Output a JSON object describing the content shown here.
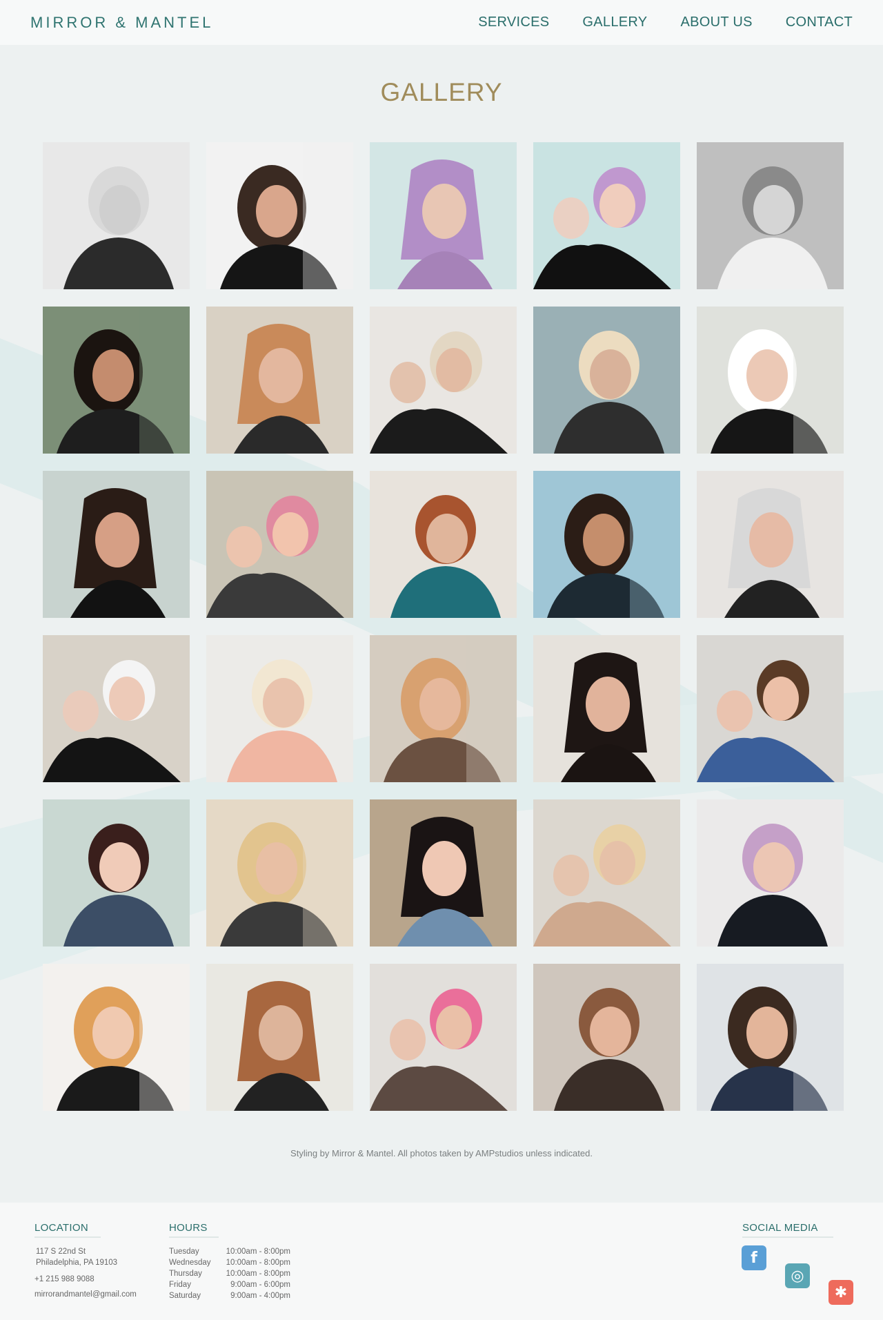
{
  "brand": {
    "logo": "MIRROR & MANTEL"
  },
  "nav": [
    {
      "label": "SERVICES"
    },
    {
      "label": "GALLERY"
    },
    {
      "label": "ABOUT US"
    },
    {
      "label": "CONTACT"
    }
  ],
  "page": {
    "title": "GALLERY",
    "credit": "Styling by Mirror & Mantel. All photos taken by AMPstudios unless indicated."
  },
  "gallery": {
    "photos": [
      {
        "name": "photo-1",
        "desc": "bw-seated-woman",
        "bg": "#e8e8e8",
        "fg": "#2b2b2b",
        "hair": "#d9d9d9",
        "skin": "#cfcfcf"
      },
      {
        "name": "photo-2",
        "desc": "braid-portrait",
        "bg": "#f2f2f2",
        "fg": "#151515",
        "hair": "#3a2a22",
        "skin": "#d9a68c"
      },
      {
        "name": "photo-3",
        "desc": "lavender-bob-profile",
        "bg": "#d3e6e5",
        "fg": "#a682b8",
        "hair": "#b28ec7",
        "skin": "#e8c6b4"
      },
      {
        "name": "photo-4",
        "desc": "lavender-bob-front",
        "bg": "#c9e3e2",
        "fg": "#111111",
        "hair": "#c098cf",
        "skin": "#f0cdbd"
      },
      {
        "name": "photo-5",
        "desc": "bw-hair-wash",
        "bg": "#bfbfbf",
        "fg": "#f0f0f0",
        "hair": "#8a8a8a",
        "skin": "#d5d5d5"
      },
      {
        "name": "photo-6",
        "desc": "styling-side-hair",
        "bg": "#7c8f77",
        "fg": "#1e1e1e",
        "hair": "#1b1410",
        "skin": "#c48c6e"
      },
      {
        "name": "photo-7",
        "desc": "copper-bob-back",
        "bg": "#d9d1c4",
        "fg": "#2a2a2a",
        "hair": "#c98a5a",
        "skin": "#e3b79e"
      },
      {
        "name": "photo-8",
        "desc": "pixie-cut-stylist",
        "bg": "#e9e6e2",
        "fg": "#1b1b1b",
        "hair": "#e3d7c3",
        "skin": "#e2bba3"
      },
      {
        "name": "photo-9",
        "desc": "blonde-pixie-color",
        "bg": "#9ab0b5",
        "fg": "#2e2e2e",
        "hair": "#ecdcc0",
        "skin": "#d9b29a"
      },
      {
        "name": "photo-10",
        "desc": "dryer-cap-client",
        "bg": "#dfe1dc",
        "fg": "#161616",
        "hair": "#ffffff",
        "skin": "#ecc9b6"
      },
      {
        "name": "photo-11",
        "desc": "braid-mustache",
        "bg": "#c8d3cf",
        "fg": "#121212",
        "hair": "#2a1c16",
        "skin": "#d69f85"
      },
      {
        "name": "photo-12",
        "desc": "pink-braid-smile",
        "bg": "#c9c4b5",
        "fg": "#3a3a3a",
        "hair": "#e08aa0",
        "skin": "#f2c4ad"
      },
      {
        "name": "photo-13",
        "desc": "teal-top-wash",
        "bg": "#e8e3dc",
        "fg": "#1f6f7a",
        "hair": "#a8542f",
        "skin": "#e0b59b"
      },
      {
        "name": "photo-14",
        "desc": "man-smiling",
        "bg": "#9fc6d6",
        "fg": "#1d2a33",
        "hair": "#2b1d16",
        "skin": "#c58e6c"
      },
      {
        "name": "photo-15",
        "desc": "color-application",
        "bg": "#e7e4e1",
        "fg": "#222222",
        "hair": "#d8d8d8",
        "skin": "#e6bba6"
      },
      {
        "name": "photo-16",
        "desc": "reading-magazine",
        "bg": "#d8d2c8",
        "fg": "#141414",
        "hair": "#f4f4f4",
        "skin": "#edcab8"
      },
      {
        "name": "photo-17",
        "desc": "stripe-shirt-wash",
        "bg": "#ecebe8",
        "fg": "#f0b6a2",
        "hair": "#f2e7d2",
        "skin": "#e9c3ad"
      },
      {
        "name": "photo-18",
        "desc": "long-hair-cut",
        "bg": "#d5ccc0",
        "fg": "#6b5141",
        "hair": "#d8a170",
        "skin": "#e6b89c"
      },
      {
        "name": "photo-19",
        "desc": "dark-angled-bob",
        "bg": "#e6e2dc",
        "fg": "#1b1412",
        "hair": "#1e1614",
        "skin": "#e1b39b"
      },
      {
        "name": "photo-20",
        "desc": "wavy-hair-smile",
        "bg": "#d9d7d3",
        "fg": "#3b5f9a",
        "hair": "#5a3b26",
        "skin": "#ecc0a8"
      },
      {
        "name": "photo-21",
        "desc": "vintage-updo-dryer",
        "bg": "#c9d8d2",
        "fg": "#3c4e66",
        "hair": "#3a1f1c",
        "skin": "#f0cbb8"
      },
      {
        "name": "photo-22",
        "desc": "blonde-strands-cut",
        "bg": "#e5d9c6",
        "fg": "#3a3a3a",
        "hair": "#e2c48e",
        "skin": "#e8bfa4"
      },
      {
        "name": "photo-23",
        "desc": "denim-shirt-waves",
        "bg": "#b8a58c",
        "fg": "#6f8fae",
        "hair": "#1a1414",
        "skin": "#efc8b4"
      },
      {
        "name": "photo-24",
        "desc": "floral-updo",
        "bg": "#dcd7cf",
        "fg": "#cfa98e",
        "hair": "#e8d1a6",
        "skin": "#e6c1a8"
      },
      {
        "name": "photo-25",
        "desc": "lavender-fringe-styling",
        "bg": "#ebeaea",
        "fg": "#171b22",
        "hair": "#c5a0c8",
        "skin": "#ecc6b4"
      },
      {
        "name": "photo-26",
        "desc": "golden-waves",
        "bg": "#f3f1ee",
        "fg": "#1a1a1a",
        "hair": "#e0a05a",
        "skin": "#f0c9b0"
      },
      {
        "name": "photo-27",
        "desc": "salon-sink-wash",
        "bg": "#e9e8e2",
        "fg": "#222222",
        "hair": "#a8673f",
        "skin": "#ddb49a"
      },
      {
        "name": "photo-28",
        "desc": "pink-streaks-cut",
        "bg": "#e2dfdb",
        "fg": "#5c4a42",
        "hair": "#ea6f9a",
        "skin": "#eac0a8"
      },
      {
        "name": "photo-29",
        "desc": "pink-underlayer",
        "bg": "#cfc6bd",
        "fg": "#3a2e28",
        "hair": "#8a5a3e",
        "skin": "#e4b59b"
      },
      {
        "name": "photo-30",
        "desc": "group-celebration",
        "bg": "#dfe3e6",
        "fg": "#27334a",
        "hair": "#3b2a20",
        "skin": "#e3b59a"
      }
    ]
  },
  "footer": {
    "location": {
      "heading": "LOCATION",
      "address1": "117 S 22nd St",
      "address2": "Philadelphia, PA 19103",
      "phone": "+1 215 988 9088",
      "email": "mirrorandmantel@gmail.com"
    },
    "hours": {
      "heading": "HOURS",
      "rows": [
        {
          "day": "Tuesday",
          "time": "10:00am - 8:00pm"
        },
        {
          "day": "Wednesday",
          "time": "10:00am - 8:00pm"
        },
        {
          "day": "Thursday",
          "time": "10:00am - 8:00pm"
        },
        {
          "day": "Friday",
          "time": "9:00am - 6:00pm"
        },
        {
          "day": "Saturday",
          "time": "9:00am - 4:00pm"
        }
      ]
    },
    "social": {
      "heading": "SOCIAL MEDIA",
      "icons": [
        {
          "name": "facebook-icon",
          "color": "#5a9fd6",
          "glyph": "f"
        },
        {
          "name": "instagram-icon",
          "color": "#5aa6b4",
          "glyph": "◎"
        },
        {
          "name": "yelp-icon",
          "color": "#ee6b5c",
          "glyph": "✱"
        }
      ]
    }
  },
  "colors": {
    "accent_teal": "#2f7470",
    "title_gold": "#a08c5b",
    "background": "#edf1f1"
  }
}
